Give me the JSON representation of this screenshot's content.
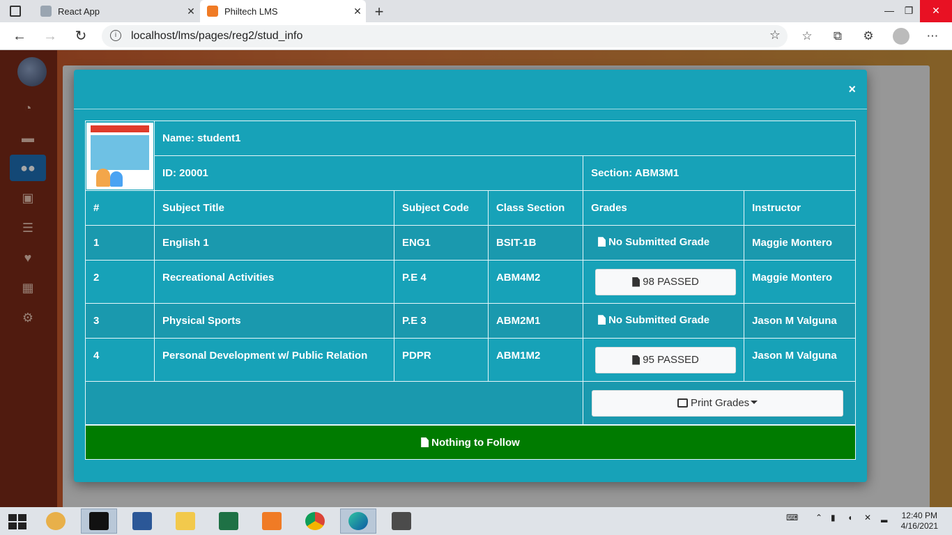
{
  "browser": {
    "tabs": [
      {
        "label": "React App",
        "active": false
      },
      {
        "label": "Philtech LMS",
        "active": true
      }
    ],
    "url": "localhost/lms/pages/reg2/stud_info",
    "win_minimize": "—",
    "win_restore": "❐",
    "win_close": "✕"
  },
  "modal": {
    "close_label": "×",
    "student": {
      "name": "Name: student1",
      "id": "ID: 20001",
      "section": "Section: ABM3M1"
    },
    "columns": [
      "#",
      "Subject Title",
      "Subject Code",
      "Class Section",
      "Grades",
      "Instructor"
    ],
    "rows": [
      {
        "num": "1",
        "title": "English 1",
        "code": "ENG1",
        "section": "BSIT-1B",
        "grade": "No Submitted Grade",
        "has_grade": false,
        "instructor": "Maggie Montero"
      },
      {
        "num": "2",
        "title": "Recreational Activities",
        "code": "P.E 4",
        "section": "ABM4M2",
        "grade": "98 PASSED",
        "has_grade": true,
        "instructor": "Maggie Montero"
      },
      {
        "num": "3",
        "title": "Physical Sports",
        "code": "P.E 3",
        "section": "ABM2M1",
        "grade": "No Submitted Grade",
        "has_grade": false,
        "instructor": "Jason M Valguna"
      },
      {
        "num": "4",
        "title": "Personal Development w/ Public Relation",
        "code": "PDPR",
        "section": "ABM1M2",
        "grade": "95 PASSED",
        "has_grade": true,
        "instructor": "Jason M Valguna"
      }
    ],
    "print_label": "Print Grades",
    "footer": "Nothing to Follow"
  },
  "taskbar": {
    "time": "12:40 PM",
    "date": "4/16/2021"
  },
  "colors": {
    "modal_bg": "#17a2b8",
    "footer_green": "#007b00",
    "sidebar": "#7c2a17"
  }
}
